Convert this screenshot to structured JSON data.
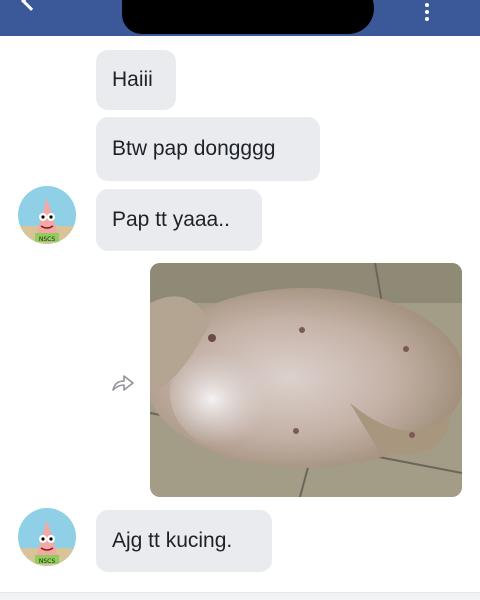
{
  "header": {
    "back_icon": "back-arrow-icon",
    "menu_icon": "more-vertical-icon",
    "color": "#3b5998"
  },
  "messages": [
    {
      "text": "Haiii"
    },
    {
      "text": "Btw pap dongggg"
    },
    {
      "text": "Pap tt yaaa.."
    },
    {
      "attachment": "photo",
      "share_icon": "share-icon"
    },
    {
      "text": "Ajg tt kucing."
    }
  ],
  "avatar_badge": "NSCS",
  "bubble_color": "#e9ebee"
}
